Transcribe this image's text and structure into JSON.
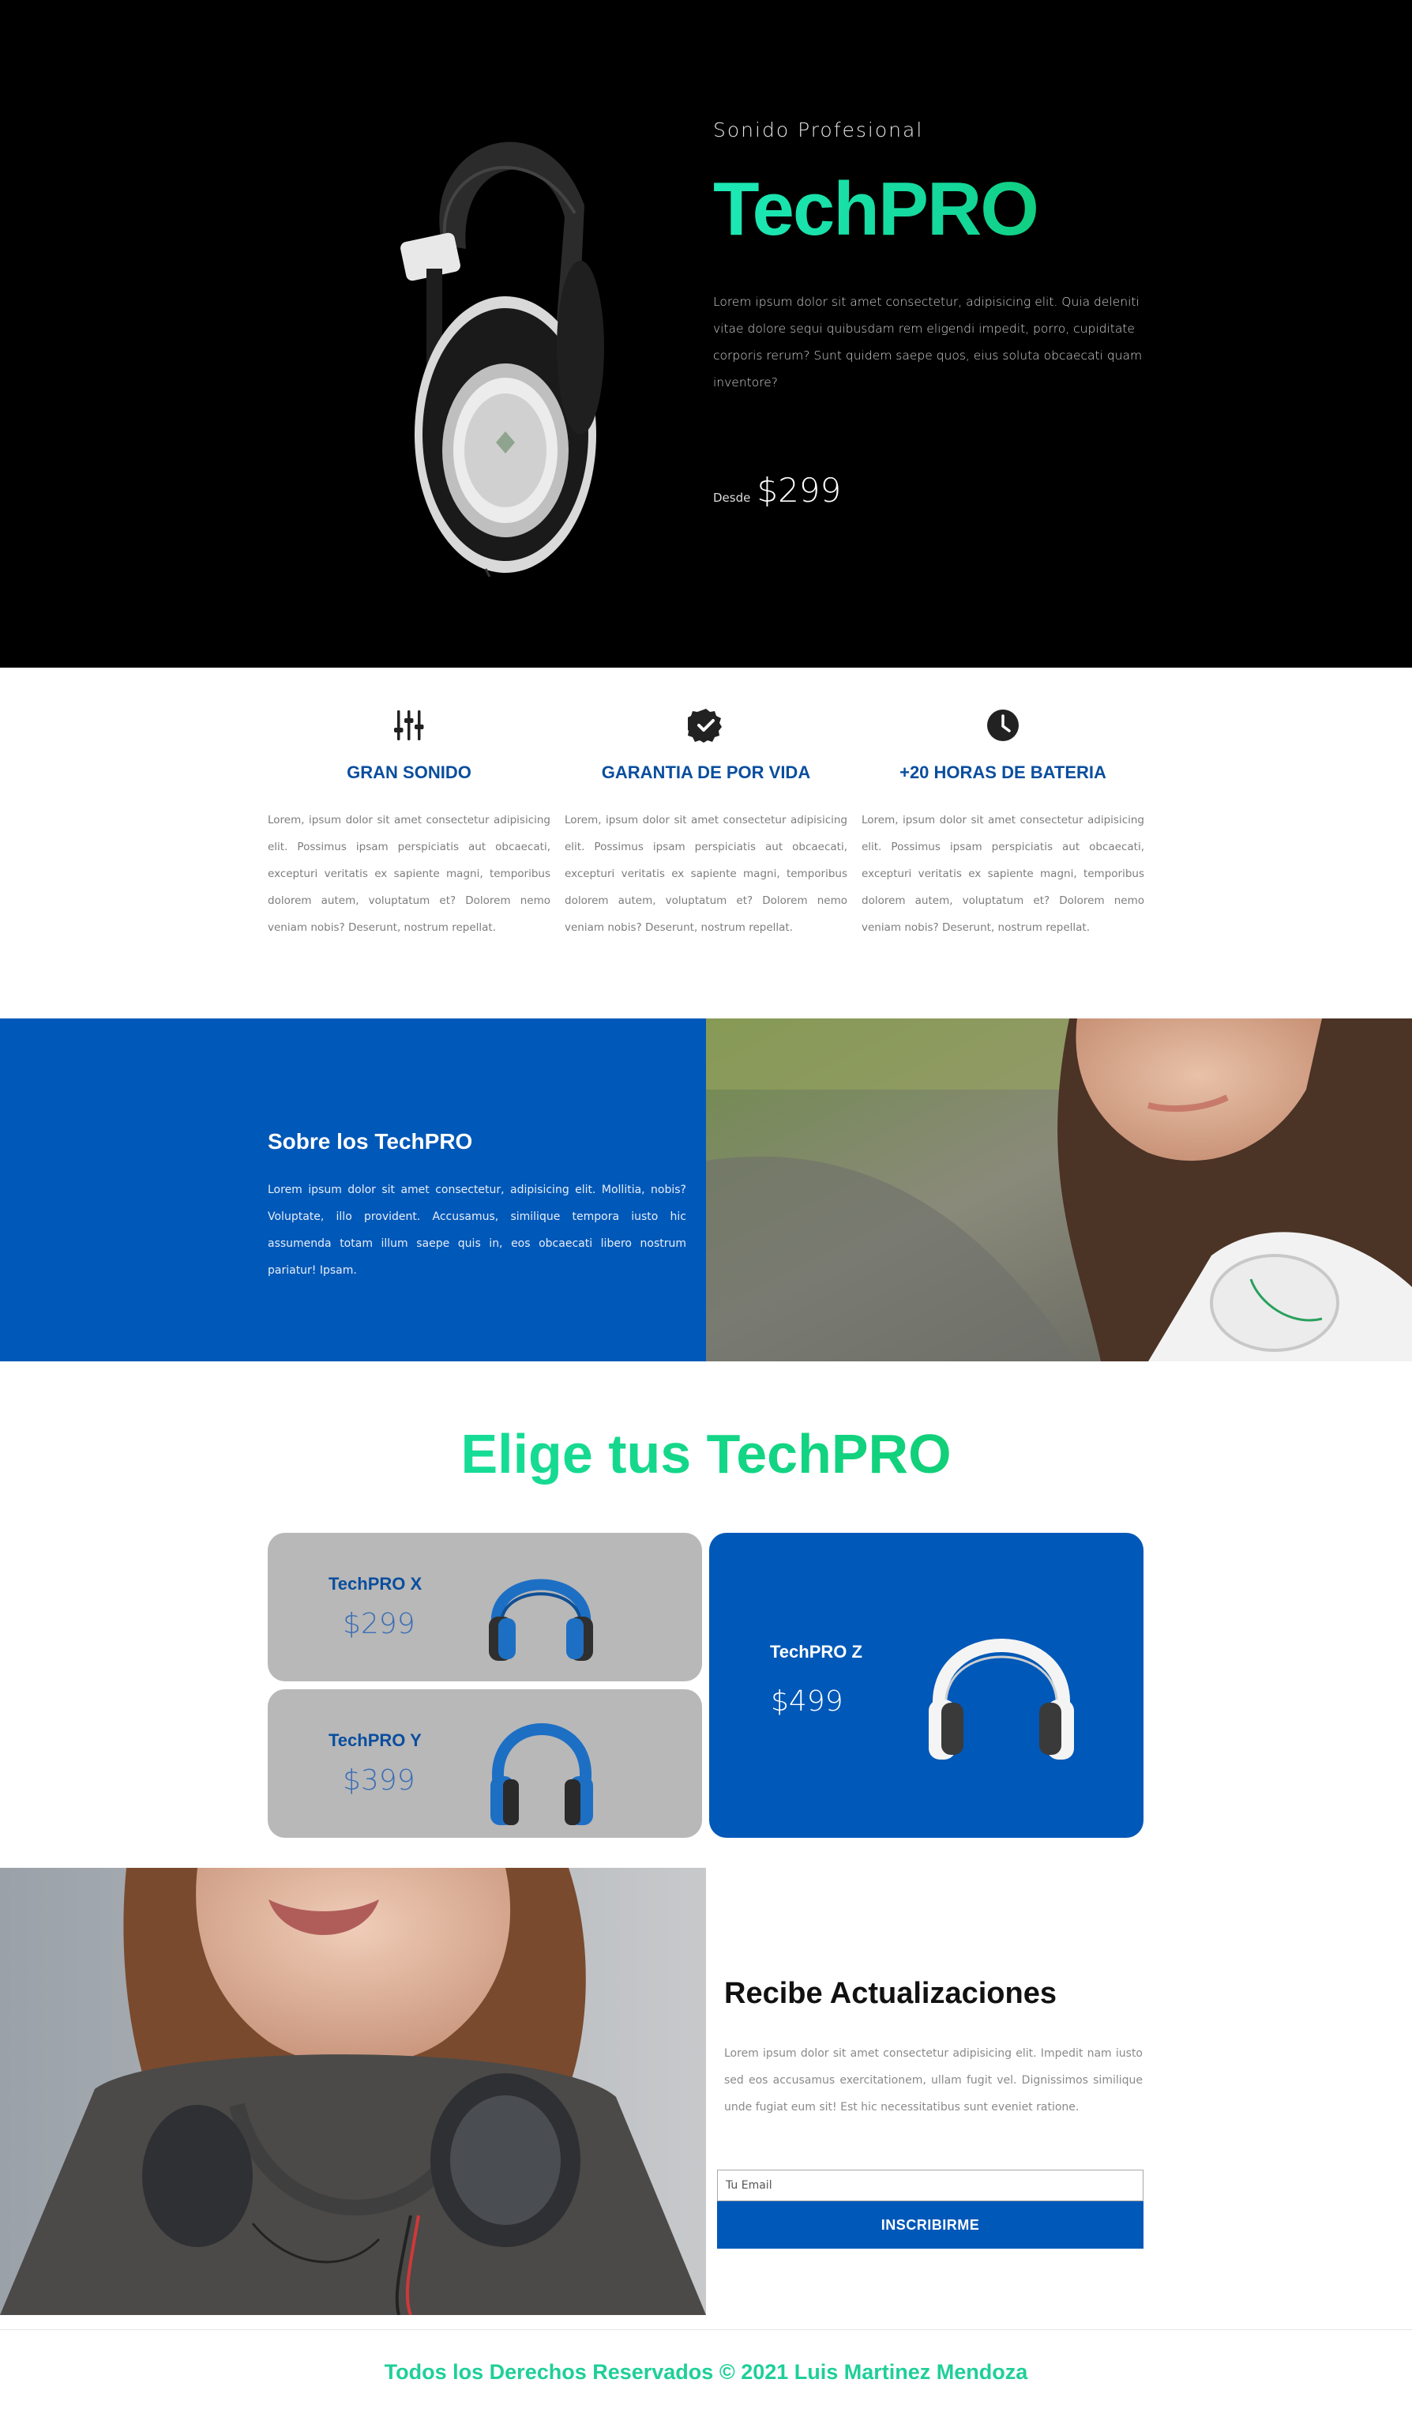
{
  "hero": {
    "tagline": "Sonido Profesional",
    "title": "TechPRO",
    "description": "Lorem ipsum dolor sit amet consectetur, adipisicing elit. Quia deleniti vitae dolore sequi quibusdam rem eligendi impedit, porro, cupiditate corporis rerum? Sunt quidem saepe quos, eius soluta obcaecati quam inventore?",
    "price_prefix": "Desde",
    "price": "$299"
  },
  "features": [
    {
      "icon": "equalizer-icon",
      "title": "GRAN SONIDO",
      "text": "Lorem, ipsum dolor sit amet consectetur adipisicing elit. Possimus ipsam perspiciatis aut obcaecati, excepturi veritatis ex sapiente magni, temporibus dolorem autem, voluptatum et? Dolorem nemo veniam nobis? Deserunt, nostrum repellat."
    },
    {
      "icon": "badge-check-icon",
      "title": "GARANTIA DE POR VIDA",
      "text": "Lorem, ipsum dolor sit amet consectetur adipisicing elit. Possimus ipsam perspiciatis aut obcaecati, excepturi veritatis ex sapiente magni, temporibus dolorem autem, voluptatum et? Dolorem nemo veniam nobis? Deserunt, nostrum repellat."
    },
    {
      "icon": "clock-icon",
      "title": "+20 HORAS DE BATERIA",
      "text": "Lorem, ipsum dolor sit amet consectetur adipisicing elit. Possimus ipsam perspiciatis aut obcaecati, excepturi veritatis ex sapiente magni, temporibus dolorem autem, voluptatum et? Dolorem nemo veniam nobis? Deserunt, nostrum repellat."
    }
  ],
  "about": {
    "title": "Sobre los TechPRO",
    "text": "Lorem ipsum dolor sit amet consectetur, adipisicing elit. Mollitia, nobis? Voluptate, illo provident. Accusamus, similique tempora iusto hic assumenda totam illum saepe quis in, eos obcaecati libero nostrum pariatur! Ipsam."
  },
  "products": {
    "title": "Elige tus TechPRO",
    "items": [
      {
        "name": "TechPRO X",
        "price": "$299"
      },
      {
        "name": "TechPRO Y",
        "price": "$399"
      },
      {
        "name": "TechPRO Z",
        "price": "$499"
      }
    ]
  },
  "newsletter": {
    "title": "Recibe Actualizaciones",
    "text": "Lorem ipsum dolor sit amet consectetur adipisicing elit. Impedit nam iusto sed eos accusamus exercitationem, ullam fugit vel. Dignissimos similique unde fugiat eum sit! Est hic necessitatibus sunt eveniet ratione.",
    "email_placeholder": "Tu Email",
    "button_label": "INSCRIBIRME"
  },
  "footer": {
    "text": "Todos los Derechos Reservados © 2021 Luis Martinez Mendoza"
  },
  "colors": {
    "hero_bg": "#000000",
    "brand_blue": "#0058b8",
    "title_blue": "#0a4e9e",
    "accent_green_start": "#1de9b6",
    "accent_green_end": "#0bc35a",
    "card_grey": "#b8b8b8"
  }
}
